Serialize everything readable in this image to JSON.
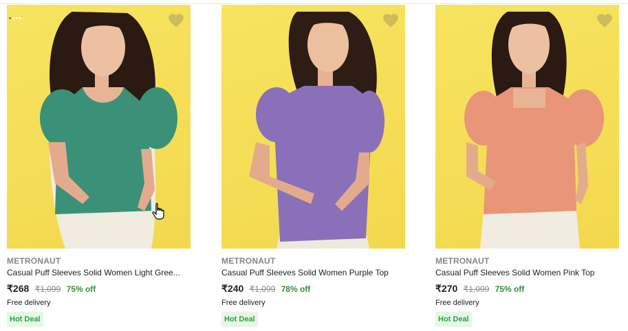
{
  "products": [
    {
      "brand": "METRONAUT",
      "title": "Casual Puff Sleeves Solid Women Light Gree...",
      "price": "₹268",
      "mrp": "₹1,099",
      "discount": "75% off",
      "delivery": "Free delivery",
      "badge": "Hot Deal",
      "top_color": "#3b9178",
      "image_alt": "Woman wearing light green puff sleeve top"
    },
    {
      "brand": "METRONAUT",
      "title": "Casual Puff Sleeves Solid Women Purple Top",
      "price": "₹240",
      "mrp": "₹1,099",
      "discount": "78% off",
      "delivery": "Free delivery",
      "badge": "Hot Deal",
      "top_color": "#8a70b8",
      "image_alt": "Woman wearing purple puff sleeve top"
    },
    {
      "brand": "METRONAUT",
      "title": "Casual Puff Sleeves Solid Women Pink Top",
      "price": "₹270",
      "mrp": "₹1,099",
      "discount": "75% off",
      "delivery": "Free delivery",
      "badge": "Hot Deal",
      "top_color": "#e8957a",
      "image_alt": "Woman wearing pink puff sleeve top"
    }
  ],
  "colors": {
    "background_yellow": "#f5dd55",
    "discount_green": "#388e3c",
    "hot_deal_bg": "#e6f7e6",
    "hot_deal_text": "#26a541",
    "wishlist_heart": "#c8b85c"
  },
  "icons": {
    "wishlist": "heart-icon",
    "carousel": "carousel-dots-icon",
    "cursor": "hand-pointer-icon"
  }
}
